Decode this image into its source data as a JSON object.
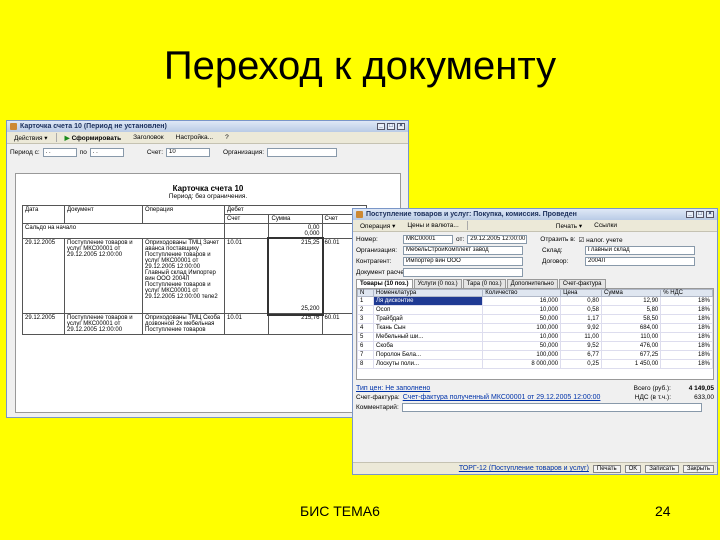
{
  "slide": {
    "title": "Переход к документу",
    "footer": "БИС ТЕМА6",
    "page_number": "24"
  },
  "win1": {
    "title": "Карточка счета 10 (Период не установлен)",
    "toolbar": {
      "actions": "Действия ▾",
      "generate": "Сформировать",
      "header": "Заголовок",
      "settings": "Настройка..."
    },
    "filters": {
      "period_label": "Период с:",
      "from": ". .",
      "to_label": "по",
      "to": ". .",
      "account_label": "Счет:",
      "account": "10",
      "org_label": "Организация:"
    },
    "report": {
      "title": "Карточка счета 10",
      "subtitle": "Период: без ограничения.",
      "headers": [
        "Дата",
        "Документ",
        "Операция",
        "Дебет"
      ],
      "subheaders": [
        "Счет",
        "Сумма",
        "Счет"
      ],
      "opening_label": "Сальдо на начало",
      "opening_values": [
        "0,00",
        "0,000"
      ],
      "rows": [
        {
          "date": "29.12.2005",
          "doc": "Поступление товаров и услуг МКС00001 от 29.12.2005 12:00:00",
          "op": "Оприходованы ТМЦ Зачет аванса поставщику Поступление товаров и услуг МКС00001 от 29.12.2005 12:00:00 Главный склад Импортер вин ООО 2004Л Поступление товаров и услуг МКС00001 от 29.12.2005 12:00:00 теле2",
          "acc": "10.01",
          "sum": "215,25",
          "cr": "60.01",
          "tail": "25,200"
        },
        {
          "date": "29.12.2005",
          "doc": "Поступление товаров и услуг МКС00001 от 29.12.2005 12:00:00",
          "op": "Оприходованы ТМЦ Скоба дозвонной 2х мебельная Поступление товаров",
          "acc": "10.01",
          "sum": "215,76",
          "cr": "60.01",
          "tail": ""
        }
      ]
    }
  },
  "win2": {
    "title": "Поступление товаров и услуг: Покупка, комиссия. Проведен",
    "toolbar": {
      "actions": "Операция ▾",
      "prices": "Цены и валюта...",
      "print": "Печать ▾",
      "docs": "Ссылки"
    },
    "form": {
      "number_label": "Номер:",
      "number": "МКС00001",
      "from_label": "от:",
      "date": "29.12.2005 12:00:00",
      "reflect_label": "Отразить в:",
      "reflect_value": "налог. учете",
      "org_label": "Организация:",
      "org": "МебельСтройКомплект завод",
      "warehouse_label": "Склад:",
      "warehouse": "Главный склад",
      "counterparty_label": "Контрагент:",
      "counterparty": "Импортер вин ООО",
      "contract_label": "Договор:",
      "contract": "2004Л",
      "docpay_label": "Документ расчетов:"
    },
    "tabs": [
      "Товары (10 поз.)",
      "Услуги (0 поз.)",
      "Тара (0 поз.)",
      "Дополнительно",
      "Счет-фактура"
    ],
    "grid": {
      "columns": [
        "N",
        "Номенклатура",
        "Количество",
        "Цена",
        "Сумма",
        "% НДС"
      ],
      "rows": [
        [
          "1",
          "Ля дисконтие",
          "16,000",
          "0,80",
          "12,90",
          "18%"
        ],
        [
          "2",
          "Осоп",
          "10,000",
          "0,58",
          "5,80",
          "18%"
        ],
        [
          "3",
          "Трайбдай",
          "50,000",
          "1,17",
          "58,50",
          "18%"
        ],
        [
          "4",
          "Ткань Сын",
          "100,000",
          "9,92",
          "684,00",
          "18%"
        ],
        [
          "5",
          "Мебельный ши...",
          "10,000",
          "11,00",
          "110,00",
          "18%"
        ],
        [
          "6",
          "Скоба",
          "50,000",
          "9,52",
          "476,00",
          "18%"
        ],
        [
          "7",
          "Поролон Бела...",
          "100,000",
          "6,77",
          "677,25",
          "18%"
        ],
        [
          "8",
          "Лоскуты поли...",
          "8 000,000",
          "0,25",
          "1 450,00",
          "18%"
        ]
      ]
    },
    "footer": {
      "price_type_label": "Тип цен: Не заполнено",
      "total_label": "Всего (руб.):",
      "total": "4 149,05",
      "vat_label": "НДС (в т.ч.):",
      "vat": "633,00",
      "invoice_label": "Счет-фактура:",
      "invoice_link": "Счет-фактура полученный МКС00001 от 29.12.2005 12:00:00",
      "comment_label": "Комментарий:"
    },
    "status": {
      "torg": "ТОРГ-12 (Поступление товаров и услуг)",
      "print": "Печать",
      "ok": "OK",
      "save": "Записать",
      "close": "Закрыть"
    }
  }
}
